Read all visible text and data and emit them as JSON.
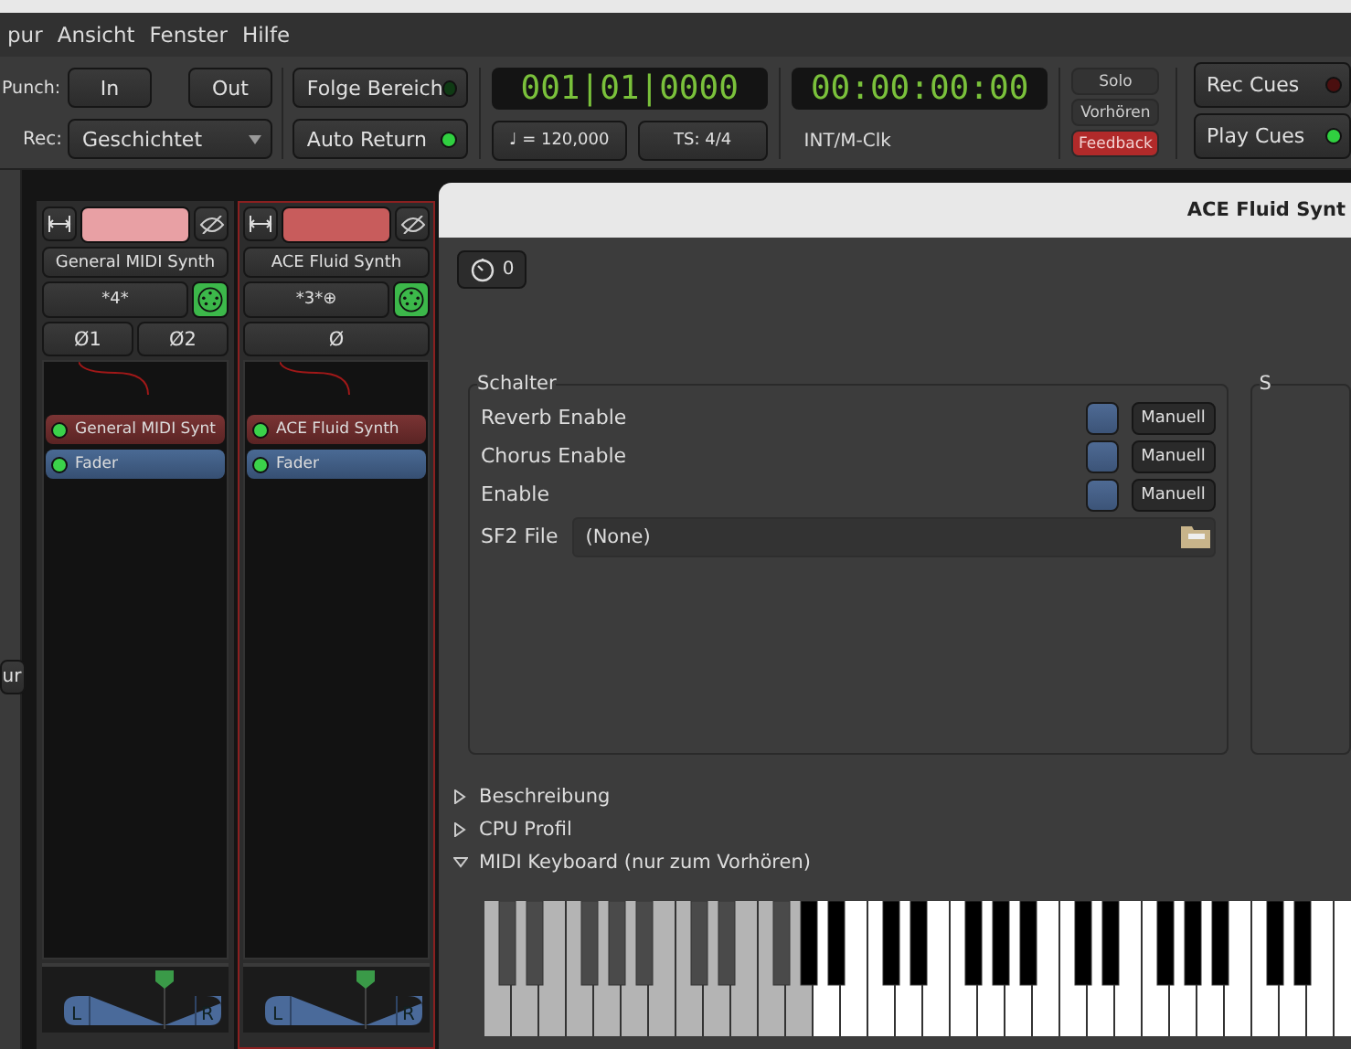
{
  "menu": [
    {
      "label": "pur"
    },
    {
      "label": "Ansicht"
    },
    {
      "label": "Fenster"
    },
    {
      "label": "Hilfe"
    }
  ],
  "transport": {
    "punch_label": "Punch:",
    "punch_in": "In",
    "punch_out": "Out",
    "rec_label": "Rec:",
    "rec_mode": "Geschichtet",
    "toggles": [
      {
        "label": "Folge Bereich",
        "on": false
      },
      {
        "label": "Auto Return",
        "on": true
      }
    ],
    "bbt_clock": "001|01|0000",
    "tempo": "♩ = 120,000",
    "meter": "TS: 4/4",
    "timecode_clock": "00:00:00:00",
    "sync_source": "INT/M-Clk",
    "monitor_buttons": [
      {
        "label": "Solo",
        "active": false
      },
      {
        "label": "Vorhören",
        "active": false
      },
      {
        "label": "Feedback",
        "active": true
      }
    ],
    "cues": [
      {
        "label": "Rec Cues",
        "kind": "rec",
        "on": false
      },
      {
        "label": "Play Cues",
        "kind": "play",
        "on": true
      }
    ]
  },
  "side_panel": {
    "button": "ur"
  },
  "strips": [
    {
      "name": "General MIDI Synth",
      "color": "#e8a0a4",
      "selected": false,
      "input": "*4*",
      "outputs": [
        "Ø1",
        "Ø2"
      ],
      "plugins": [
        {
          "name": "General MIDI Synt",
          "kind": "instrument",
          "active": true
        },
        {
          "name": "Fader",
          "kind": "fader",
          "active": true
        }
      ],
      "pan_left": "L",
      "pan_right": "R"
    },
    {
      "name": "ACE Fluid Synth",
      "color": "#c85c5c",
      "selected": true,
      "input": "*3*⊕",
      "outputs": [
        "Ø"
      ],
      "plugins": [
        {
          "name": "ACE Fluid Synth",
          "kind": "instrument",
          "active": true
        },
        {
          "name": "Fader",
          "kind": "fader",
          "active": true
        }
      ],
      "pan_left": "L",
      "pan_right": "R"
    }
  ],
  "plugin_window": {
    "title": "ACE Fluid Synt",
    "dsp_load": "0",
    "groups": [
      {
        "title": "Schalter",
        "controls": [
          {
            "kind": "toggle",
            "label": "Reverb Enable",
            "checked": false,
            "mode_button": "Manuell"
          },
          {
            "kind": "toggle",
            "label": "Chorus Enable",
            "checked": false,
            "mode_button": "Manuell"
          },
          {
            "kind": "toggle",
            "label": "Enable",
            "checked": false,
            "mode_button": "Manuell"
          },
          {
            "kind": "file",
            "label": "SF2 File",
            "value": "(None)"
          }
        ]
      },
      {
        "title": "S"
      }
    ],
    "expanders": [
      {
        "label": "Beschreibung",
        "expanded": false
      },
      {
        "label": "CPU Profil",
        "expanded": false
      },
      {
        "label": "MIDI Keyboard (nur zum Vorhören)",
        "expanded": true
      }
    ]
  }
}
